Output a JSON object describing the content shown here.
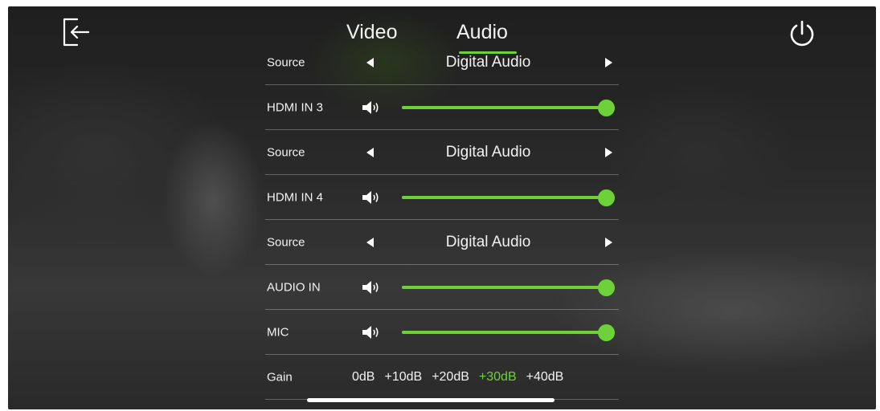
{
  "accent_color": "#6fd13a",
  "header": {
    "back_icon": "exit-arrow-icon",
    "power_icon": "power-icon",
    "tabs": [
      {
        "label": "Video",
        "active": false
      },
      {
        "label": "Audio",
        "active": true
      }
    ]
  },
  "audio": {
    "source_row_top": {
      "label": "Source",
      "value": "Digital Audio"
    },
    "channels": [
      {
        "label": "HDMI IN 3",
        "volume": 1.0,
        "icon": "speaker-icon"
      },
      {
        "label": "HDMI IN 4",
        "volume": 1.0,
        "icon": "speaker-icon"
      },
      {
        "label": "AUDIO IN",
        "volume": 1.0,
        "icon": "speaker-icon"
      },
      {
        "label": "MIC",
        "volume": 1.0,
        "icon": "speaker-icon"
      }
    ],
    "sources": [
      {
        "label": "Source",
        "value": "Digital Audio"
      },
      {
        "label": "Source",
        "value": "Digital Audio"
      }
    ],
    "gain": {
      "label": "Gain",
      "options": [
        "0dB",
        "+10dB",
        "+20dB",
        "+30dB",
        "+40dB"
      ],
      "selected": "+30dB"
    }
  }
}
